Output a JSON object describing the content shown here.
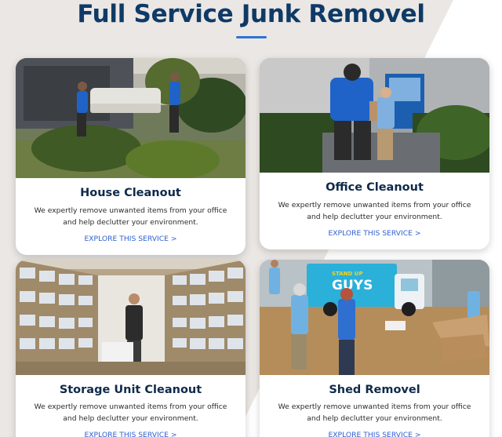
{
  "section": {
    "title": "Full Service Junk Removel"
  },
  "cards": [
    {
      "title": "House Cleanout",
      "description": "We expertly remove unwanted items from your office and help declutter your environment.",
      "link": "EXPLORE THIS SERVICE >",
      "image": "photo-movers-carrying-couch"
    },
    {
      "title": "Office Cleanout",
      "description": "We expertly remove unwanted items from your office and help declutter your environment.",
      "link": "EXPLORE THIS SERVICE >",
      "image": "photo-movers-carrying-box-at-blue-door"
    },
    {
      "title": "Storage Unit Cleanout",
      "description": "We expertly remove unwanted items from your office and help declutter your environment.",
      "link": "EXPLORE THIS SERVICE >",
      "image": "photo-storage-shelves-with-boxes"
    },
    {
      "title": "Shed Removel",
      "description": "We expertly remove unwanted items from your office and help declutter your environment.",
      "link": "EXPLORE THIS SERVICE >",
      "image": "photo-crew-handshake-by-truck"
    }
  ],
  "truck_logo_text": [
    "STAND UP",
    "GUYS"
  ],
  "colors": {
    "title": "#0f3a66",
    "accent": "#2f74d0",
    "link": "#2f5fd0",
    "background": "#ebe7e4",
    "card": "#ffffff"
  }
}
